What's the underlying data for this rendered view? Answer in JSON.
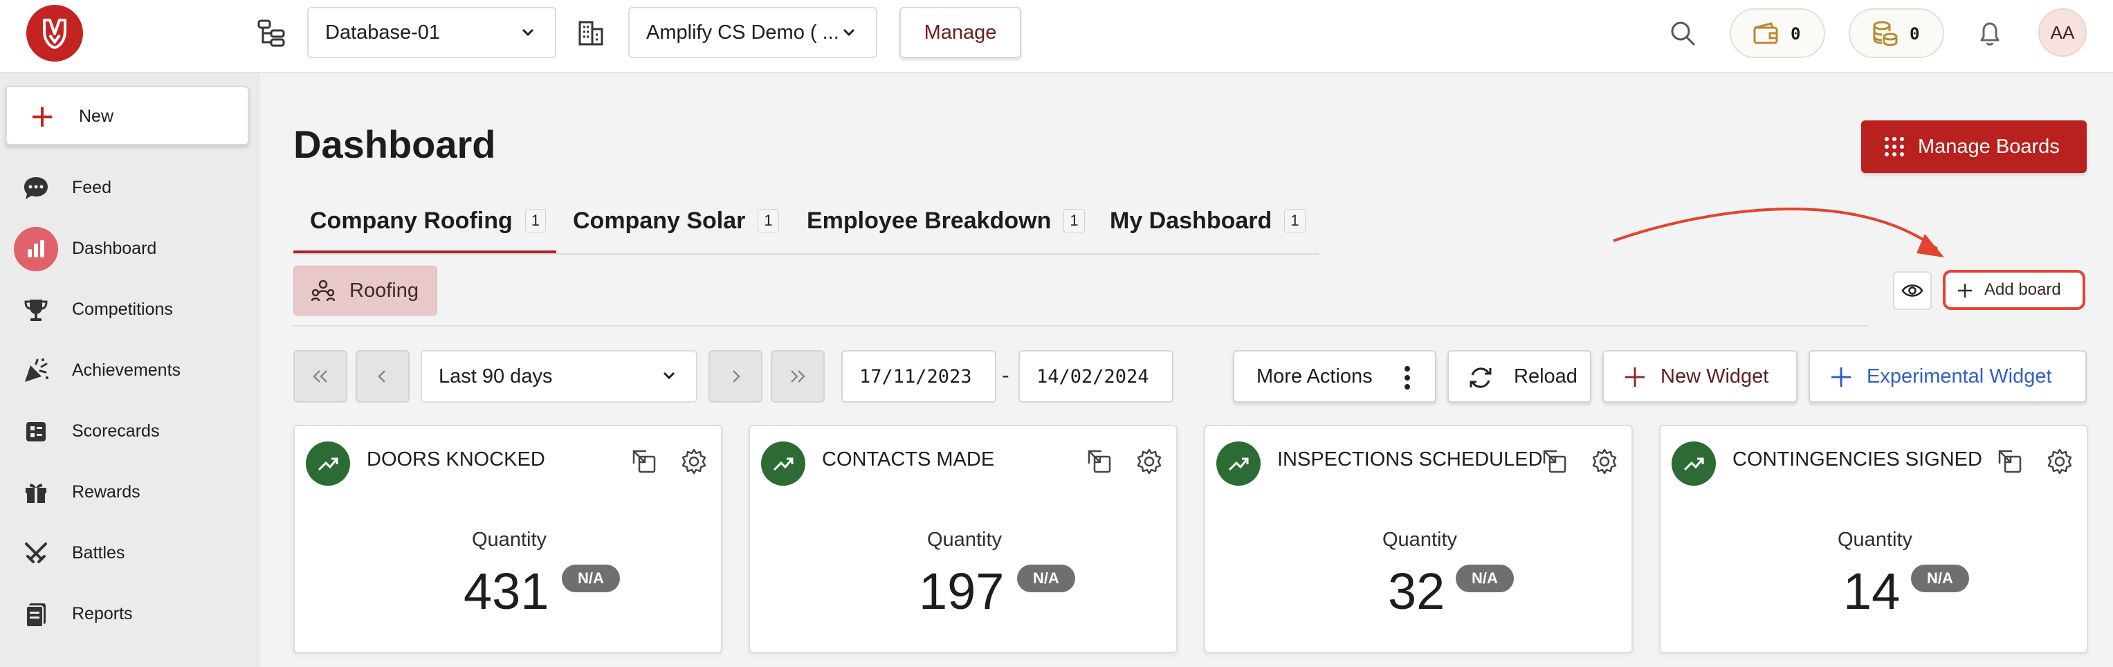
{
  "colors": {
    "brand": "#c32421",
    "accent": "#a3272a",
    "success": "#2d6b35",
    "annotation": "#e2442f"
  },
  "header": {
    "database_select": "Database-01",
    "company_select": "Amplify CS Demo ( ...",
    "manage_label": "Manage",
    "wallet_count": "0",
    "coins_count": "0",
    "avatar_initials": "AA"
  },
  "sidebar": {
    "new_label": "New",
    "items": [
      {
        "label": "Feed",
        "icon": "chat-bubble-icon"
      },
      {
        "label": "Dashboard",
        "icon": "bar-chart-icon",
        "active": true
      },
      {
        "label": "Competitions",
        "icon": "trophy-icon"
      },
      {
        "label": "Achievements",
        "icon": "party-popper-icon"
      },
      {
        "label": "Scorecards",
        "icon": "scorecard-icon"
      },
      {
        "label": "Rewards",
        "icon": "gift-icon"
      },
      {
        "label": "Battles",
        "icon": "crossed-swords-icon"
      },
      {
        "label": "Reports",
        "icon": "reports-icon"
      }
    ]
  },
  "main": {
    "title": "Dashboard",
    "manage_boards_label": "Manage Boards",
    "tabs": [
      {
        "label": "Company Roofing",
        "count": "1",
        "active": true
      },
      {
        "label": "Company Solar",
        "count": "1"
      },
      {
        "label": "Employee Breakdown",
        "count": "1"
      },
      {
        "label": "My Dashboard",
        "count": "1"
      }
    ],
    "board_chip": "Roofing",
    "add_board_label": "Add board",
    "toolbar": {
      "range_select": "Last 90 days",
      "date_start": "17/11/2023",
      "date_end": "14/02/2024",
      "date_separator": "-",
      "more_actions": "More Actions",
      "reload": "Reload",
      "new_widget": "New Widget",
      "experimental_widget": "Experimental Widget"
    },
    "widgets": [
      {
        "title": "DOORS KNOCKED",
        "metric_label": "Quantity",
        "value": "431",
        "badge": "N/A"
      },
      {
        "title": "CONTACTS MADE",
        "metric_label": "Quantity",
        "value": "197",
        "badge": "N/A"
      },
      {
        "title": "INSPECTIONS SCHEDULED",
        "metric_label": "Quantity",
        "value": "32",
        "badge": "N/A"
      },
      {
        "title": "CONTINGENCIES SIGNED",
        "metric_label": "Quantity",
        "value": "14",
        "badge": "N/A"
      }
    ]
  }
}
